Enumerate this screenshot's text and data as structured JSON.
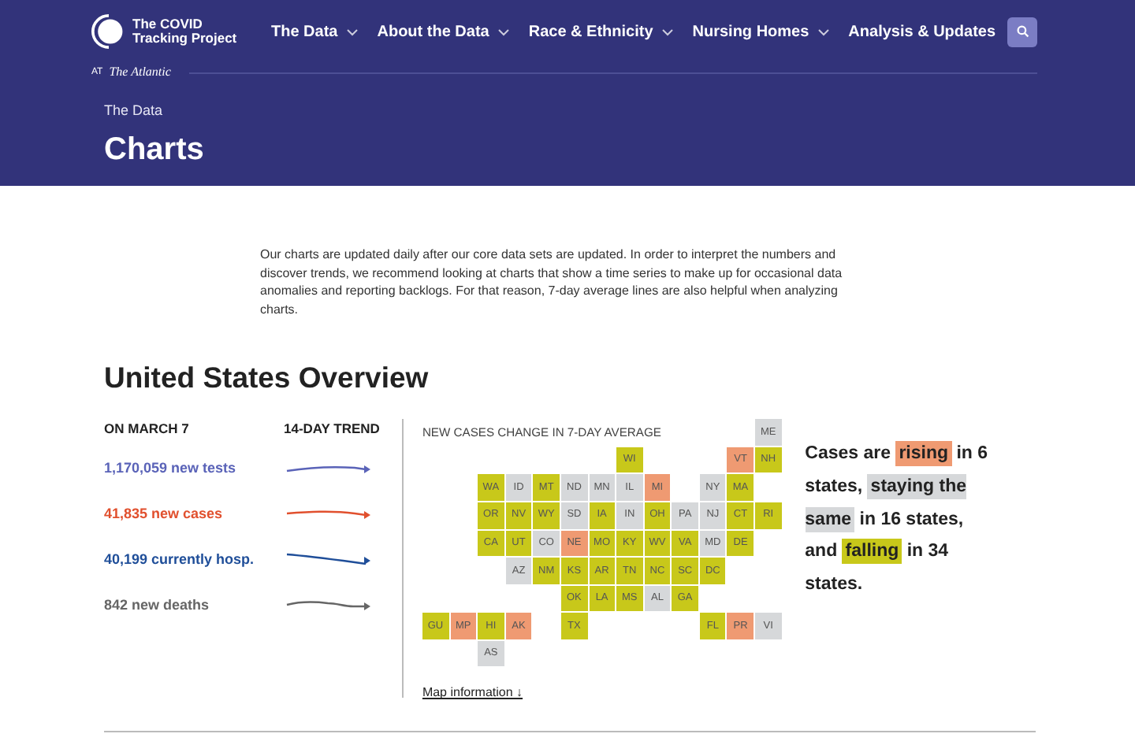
{
  "brand": {
    "name": "The COVID Tracking Project",
    "partner_prefix": "AT",
    "partner": "The Atlantic"
  },
  "nav": [
    {
      "label": "The Data",
      "dropdown": true
    },
    {
      "label": "About the Data",
      "dropdown": true
    },
    {
      "label": "Race & Ethnicity",
      "dropdown": true
    },
    {
      "label": "Nursing Homes",
      "dropdown": true
    },
    {
      "label": "Analysis & Updates",
      "dropdown": false
    }
  ],
  "breadcrumb": "The Data",
  "page_title": "Charts",
  "intro": "Our charts are updated daily after our core data sets are updated. In order to interpret the numbers and discover trends, we recommend looking at charts that show a time series to make up for occasional data anomalies and reporting backlogs. For that reason, 7-day average lines are also helpful when analyzing charts.",
  "overview": {
    "title": "United States Overview",
    "date_heading": "ON MARCH 7",
    "trend_heading": "14-DAY TREND",
    "metrics": [
      {
        "text": "1,170,059 new tests",
        "color": "#5a63b8"
      },
      {
        "text": "41,835 new cases",
        "color": "#e1502e"
      },
      {
        "text": "40,199 currently hosp.",
        "color": "#1f4e99"
      },
      {
        "text": "842 new deaths",
        "color": "#666666"
      }
    ],
    "map": {
      "title": "NEW CASES CHANGE IN 7-DAY AVERAGE",
      "link": "Map information",
      "link_icon": "↓",
      "rows": [
        [
          null,
          null,
          null,
          null,
          null,
          null,
          null,
          null,
          null,
          null,
          null,
          null,
          {
            "label": "ME",
            "color": "#d6d8da"
          }
        ],
        [
          null,
          null,
          null,
          null,
          null,
          null,
          null,
          {
            "label": "WI",
            "color": "#c8c81a"
          },
          null,
          null,
          null,
          {
            "label": "VT",
            "color": "#ef9a72"
          },
          {
            "label": "NH",
            "color": "#c8c81a"
          }
        ],
        [
          null,
          null,
          {
            "label": "WA",
            "color": "#c8c81a"
          },
          {
            "label": "ID",
            "color": "#d6d8da"
          },
          {
            "label": "MT",
            "color": "#c8c81a"
          },
          {
            "label": "ND",
            "color": "#d6d8da"
          },
          {
            "label": "MN",
            "color": "#d6d8da"
          },
          {
            "label": "IL",
            "color": "#d6d8da"
          },
          {
            "label": "MI",
            "color": "#ef9a72"
          },
          null,
          {
            "label": "NY",
            "color": "#d6d8da"
          },
          {
            "label": "MA",
            "color": "#c8c81a"
          },
          null
        ],
        [
          null,
          null,
          {
            "label": "OR",
            "color": "#c8c81a"
          },
          {
            "label": "NV",
            "color": "#c8c81a"
          },
          {
            "label": "WY",
            "color": "#c8c81a"
          },
          {
            "label": "SD",
            "color": "#d6d8da"
          },
          {
            "label": "IA",
            "color": "#c8c81a"
          },
          {
            "label": "IN",
            "color": "#d6d8da"
          },
          {
            "label": "OH",
            "color": "#c8c81a"
          },
          {
            "label": "PA",
            "color": "#d6d8da"
          },
          {
            "label": "NJ",
            "color": "#d6d8da"
          },
          {
            "label": "CT",
            "color": "#c8c81a"
          },
          {
            "label": "RI",
            "color": "#c8c81a"
          }
        ],
        [
          null,
          null,
          {
            "label": "CA",
            "color": "#c8c81a"
          },
          {
            "label": "UT",
            "color": "#c8c81a"
          },
          {
            "label": "CO",
            "color": "#d6d8da"
          },
          {
            "label": "NE",
            "color": "#ef9a72"
          },
          {
            "label": "MO",
            "color": "#c8c81a"
          },
          {
            "label": "KY",
            "color": "#c8c81a"
          },
          {
            "label": "WV",
            "color": "#c8c81a"
          },
          {
            "label": "VA",
            "color": "#c8c81a"
          },
          {
            "label": "MD",
            "color": "#d6d8da"
          },
          {
            "label": "DE",
            "color": "#c8c81a"
          },
          null
        ],
        [
          null,
          null,
          null,
          {
            "label": "AZ",
            "color": "#d6d8da"
          },
          {
            "label": "NM",
            "color": "#c8c81a"
          },
          {
            "label": "KS",
            "color": "#c8c81a"
          },
          {
            "label": "AR",
            "color": "#c8c81a"
          },
          {
            "label": "TN",
            "color": "#c8c81a"
          },
          {
            "label": "NC",
            "color": "#c8c81a"
          },
          {
            "label": "SC",
            "color": "#c8c81a"
          },
          {
            "label": "DC",
            "color": "#c8c81a"
          },
          null,
          null
        ],
        [
          null,
          null,
          null,
          null,
          null,
          {
            "label": "OK",
            "color": "#c8c81a"
          },
          {
            "label": "LA",
            "color": "#c8c81a"
          },
          {
            "label": "MS",
            "color": "#c8c81a"
          },
          {
            "label": "AL",
            "color": "#d6d8da"
          },
          {
            "label": "GA",
            "color": "#c8c81a"
          },
          null,
          null,
          null
        ],
        [
          {
            "label": "GU",
            "color": "#c8c81a"
          },
          {
            "label": "MP",
            "color": "#ef9a72"
          },
          {
            "label": "HI",
            "color": "#c8c81a"
          },
          {
            "label": "AK",
            "color": "#ef9a72"
          },
          null,
          {
            "label": "TX",
            "color": "#c8c81a"
          },
          null,
          null,
          null,
          null,
          {
            "label": "FL",
            "color": "#c8c81a"
          },
          {
            "label": "PR",
            "color": "#ef9a72"
          },
          {
            "label": "VI",
            "color": "#d6d8da"
          }
        ],
        [
          null,
          null,
          {
            "label": "AS",
            "color": "#d6d8da"
          },
          null,
          null,
          null,
          null,
          null,
          null,
          null,
          null,
          null,
          null
        ]
      ]
    },
    "summary": [
      {
        "text": "Cases are "
      },
      {
        "text": "rising",
        "color": "#ef9a72"
      },
      {
        "text": " in 6 states, "
      },
      {
        "text": "staying the same",
        "color": "#d6d8da"
      },
      {
        "text": " in 16 states, and "
      },
      {
        "text": "falling",
        "color": "#c8c81a"
      },
      {
        "text": " in 34 states."
      }
    ]
  }
}
